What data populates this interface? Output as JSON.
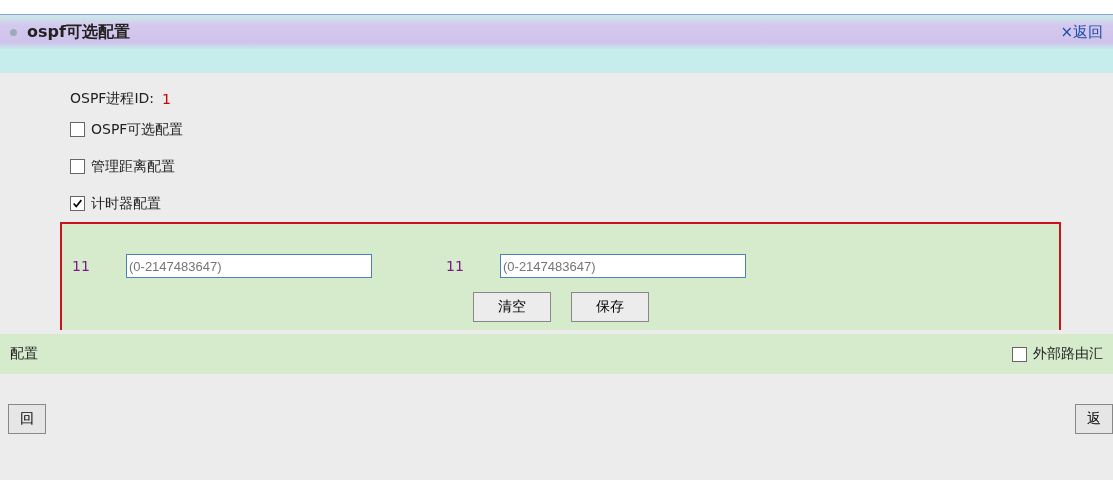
{
  "header": {
    "title": "ospf可选配置",
    "back_link": "×返回"
  },
  "process_id": {
    "label": "OSPF进程ID:",
    "value": "1"
  },
  "options": [
    {
      "label": "OSPF可选配置",
      "checked": false
    },
    {
      "label": "管理距离配置",
      "checked": false
    },
    {
      "label": "计时器配置",
      "checked": true
    }
  ],
  "timer_panel": {
    "fields": [
      {
        "value": "11",
        "placeholder": "(0-2147483647)"
      },
      {
        "value": "11",
        "placeholder": "(0-2147483647)"
      }
    ],
    "buttons": [
      "清空",
      "保存"
    ]
  },
  "lower_left": {
    "label": "配置"
  },
  "lower_right": [
    {
      "label": "外部路由汇",
      "checked": false
    }
  ],
  "footer_buttons": [
    "回",
    "返"
  ]
}
